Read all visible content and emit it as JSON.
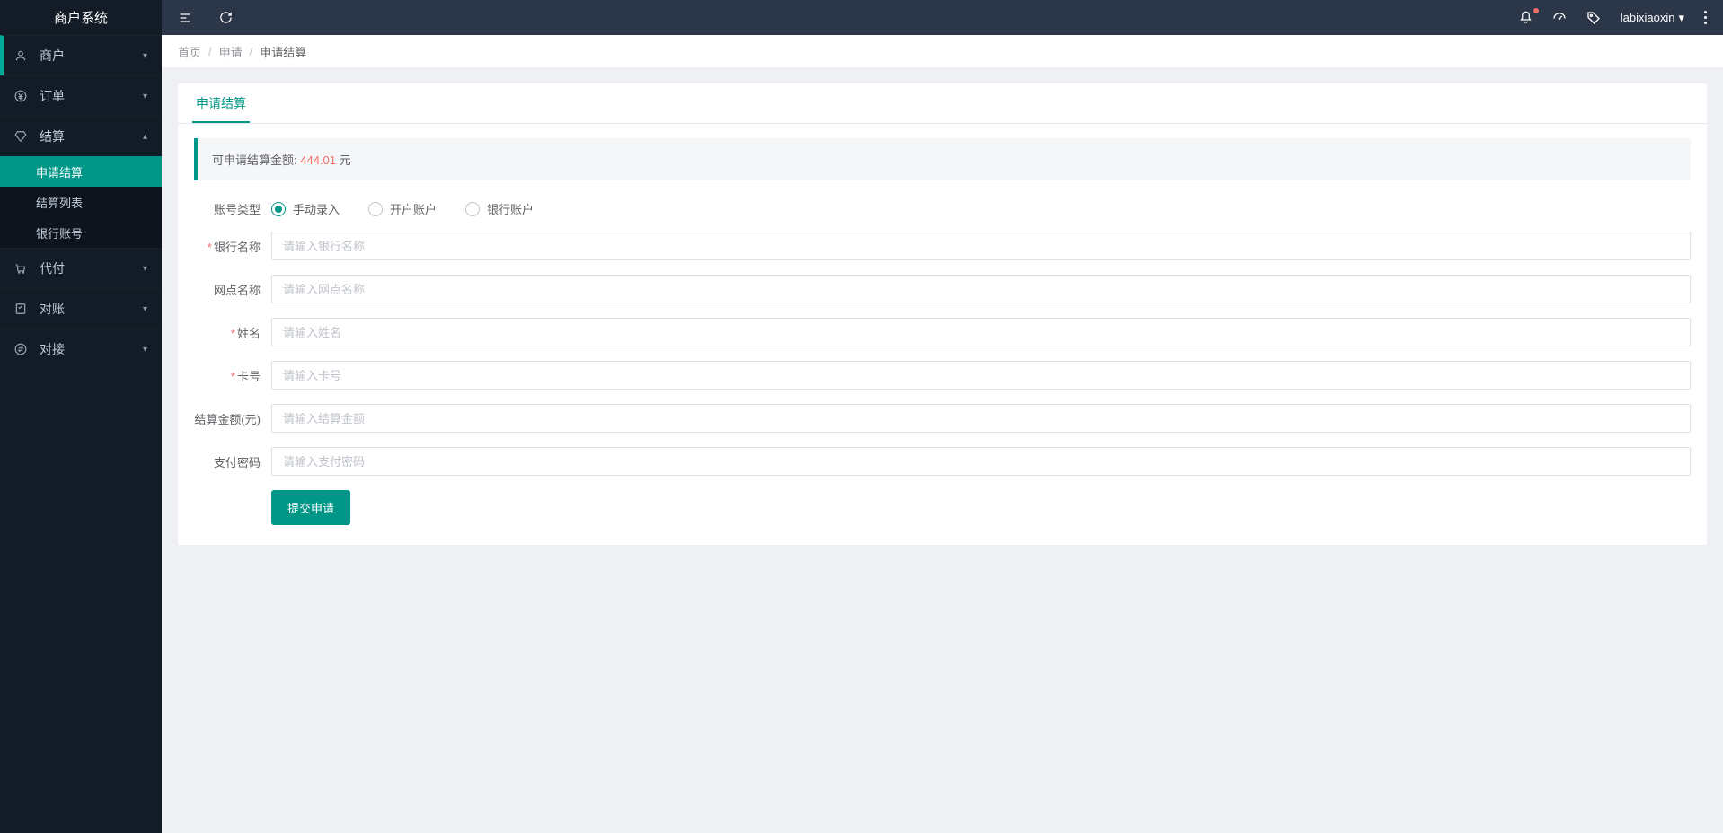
{
  "app": {
    "title": "商户系统"
  },
  "sidebar": {
    "items": [
      {
        "label": "商户",
        "icon": "user"
      },
      {
        "label": "订单",
        "icon": "yen"
      },
      {
        "label": "结算",
        "icon": "diamond",
        "expanded": true,
        "subitems": [
          {
            "label": "申请结算",
            "active": true
          },
          {
            "label": "结算列表"
          },
          {
            "label": "银行账号"
          }
        ]
      },
      {
        "label": "代付",
        "icon": "cart"
      },
      {
        "label": "对账",
        "icon": "check"
      },
      {
        "label": "对接",
        "icon": "swap"
      }
    ]
  },
  "topbar": {
    "username": "labixiaoxin"
  },
  "breadcrumb": {
    "home": "首页",
    "apply": "申请",
    "current": "申请结算"
  },
  "tab": {
    "label": "申请结算"
  },
  "notice": {
    "prefix": "可申请结算金额:",
    "amount": "444.01",
    "unit": "元"
  },
  "form": {
    "account_type": {
      "label": "账号类型",
      "options": [
        "手动录入",
        "开户账户",
        "银行账户"
      ]
    },
    "bank_name": {
      "label": "银行名称",
      "placeholder": "请输入银行名称",
      "required": true
    },
    "branch_name": {
      "label": "网点名称",
      "placeholder": "请输入网点名称"
    },
    "name": {
      "label": "姓名",
      "placeholder": "请输入姓名",
      "required": true
    },
    "card_no": {
      "label": "卡号",
      "placeholder": "请输入卡号",
      "required": true
    },
    "amount": {
      "label": "结算金额(元)",
      "placeholder": "请输入结算金额"
    },
    "password": {
      "label": "支付密码",
      "placeholder": "请输入支付密码"
    },
    "submit": "提交申请"
  }
}
